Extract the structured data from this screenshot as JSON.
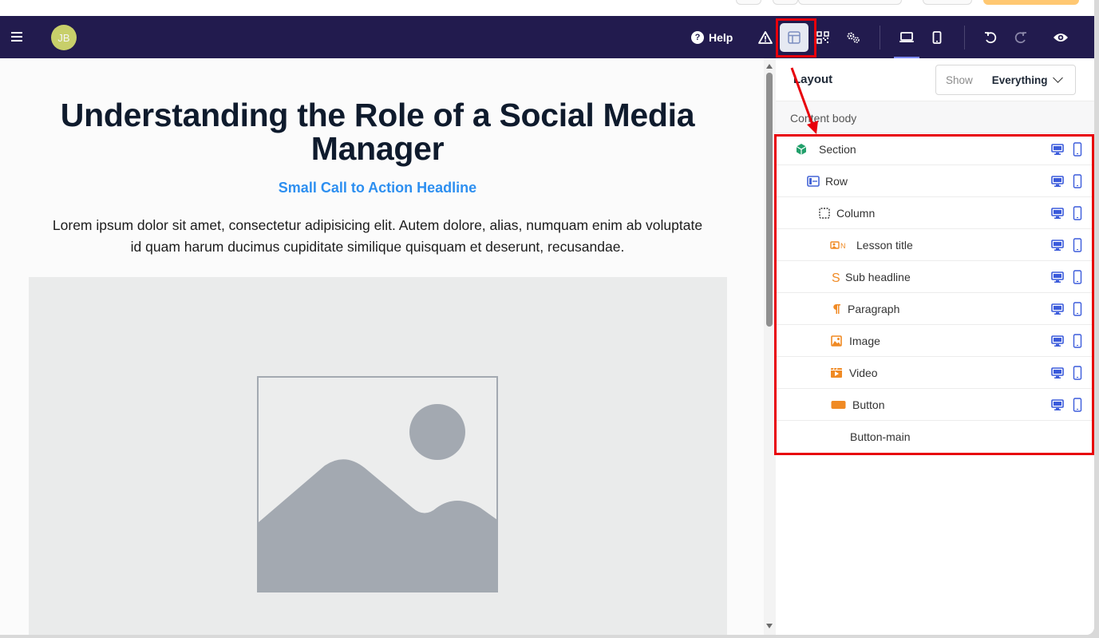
{
  "navbar": {
    "avatar_initials": "JB",
    "help_label": "Help",
    "icons": [
      "menu-icon",
      "warning-icon",
      "layout-icon",
      "qr-code-icon",
      "settings-icon",
      "desktop-view-icon",
      "mobile-view-icon",
      "undo-icon",
      "redo-icon",
      "preview-icon"
    ]
  },
  "content": {
    "title": "Understanding the Role of a Social Media Manager",
    "subtitle": "Small Call to Action Headline",
    "paragraph": "Lorem ipsum dolor sit amet, consectetur adipisicing elit. Autem dolore, alias, numquam enim ab voluptate id quam harum ducimus cupiditate similique quisquam et deserunt, recusandae."
  },
  "panel": {
    "title": "Layout",
    "show_label": "Show",
    "show_value": "Everything",
    "content_body_label": "Content body",
    "items": [
      {
        "label": "Section",
        "icon": "cube-icon",
        "color": "#22a06b"
      },
      {
        "label": "Row",
        "icon": "row-icon",
        "color": "#4565d6"
      },
      {
        "label": "Column",
        "icon": "column-icon",
        "color": "#333333"
      },
      {
        "label": "Lesson title",
        "icon": "lesson-title-icon",
        "color": "#f08a24"
      },
      {
        "label": "Sub headline",
        "icon": "sub-headline-icon",
        "color": "#f08a24"
      },
      {
        "label": "Paragraph",
        "icon": "paragraph-icon",
        "color": "#f08a24"
      },
      {
        "label": "Image",
        "icon": "image-icon",
        "color": "#f08a24"
      },
      {
        "label": "Video",
        "icon": "video-icon",
        "color": "#f08a24"
      },
      {
        "label": "Button",
        "icon": "button-icon",
        "color": "#f08a24"
      },
      {
        "label": "Button-main",
        "icon": "",
        "color": ""
      }
    ]
  },
  "colors": {
    "navbar_bg": "#221b4e",
    "highlight_red": "#e8000b",
    "accent_blue": "#2d8ff0",
    "device_icon_blue": "#3b5bdb"
  }
}
